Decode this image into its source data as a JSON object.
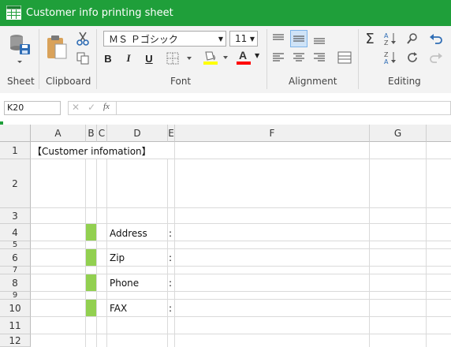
{
  "window": {
    "title": "Customer info printing sheet"
  },
  "ribbon": {
    "groups": [
      {
        "label": "Sheet"
      },
      {
        "label": "Clipboard"
      },
      {
        "label": "Font"
      },
      {
        "label": "Alignment"
      },
      {
        "label": "Editing"
      }
    ],
    "font_name": "ＭＳ Ｐゴシック",
    "font_size": "11",
    "bold": "B",
    "italic": "I",
    "underline": "U",
    "font_color_letter": "A",
    "fill_color": "#ffff00",
    "font_color": "#ff0000"
  },
  "formula_bar": {
    "name_box": "K20",
    "fx": "fx",
    "formula": ""
  },
  "sheet": {
    "columns": [
      "A",
      "B",
      "C",
      "D",
      "E",
      "F",
      "G"
    ],
    "rows": [
      "1",
      "2",
      "3",
      "4",
      "5",
      "6",
      "7",
      "8",
      "9",
      "10",
      "11",
      "12"
    ],
    "cells": {
      "a1": "【Customer infomation】",
      "d4": "Address",
      "e4": ":",
      "d6": "Zip",
      "e6": ":",
      "d8": "Phone",
      "e8": ":",
      "d10": "FAX",
      "e10": ":"
    },
    "mark_color": "#92d050"
  }
}
